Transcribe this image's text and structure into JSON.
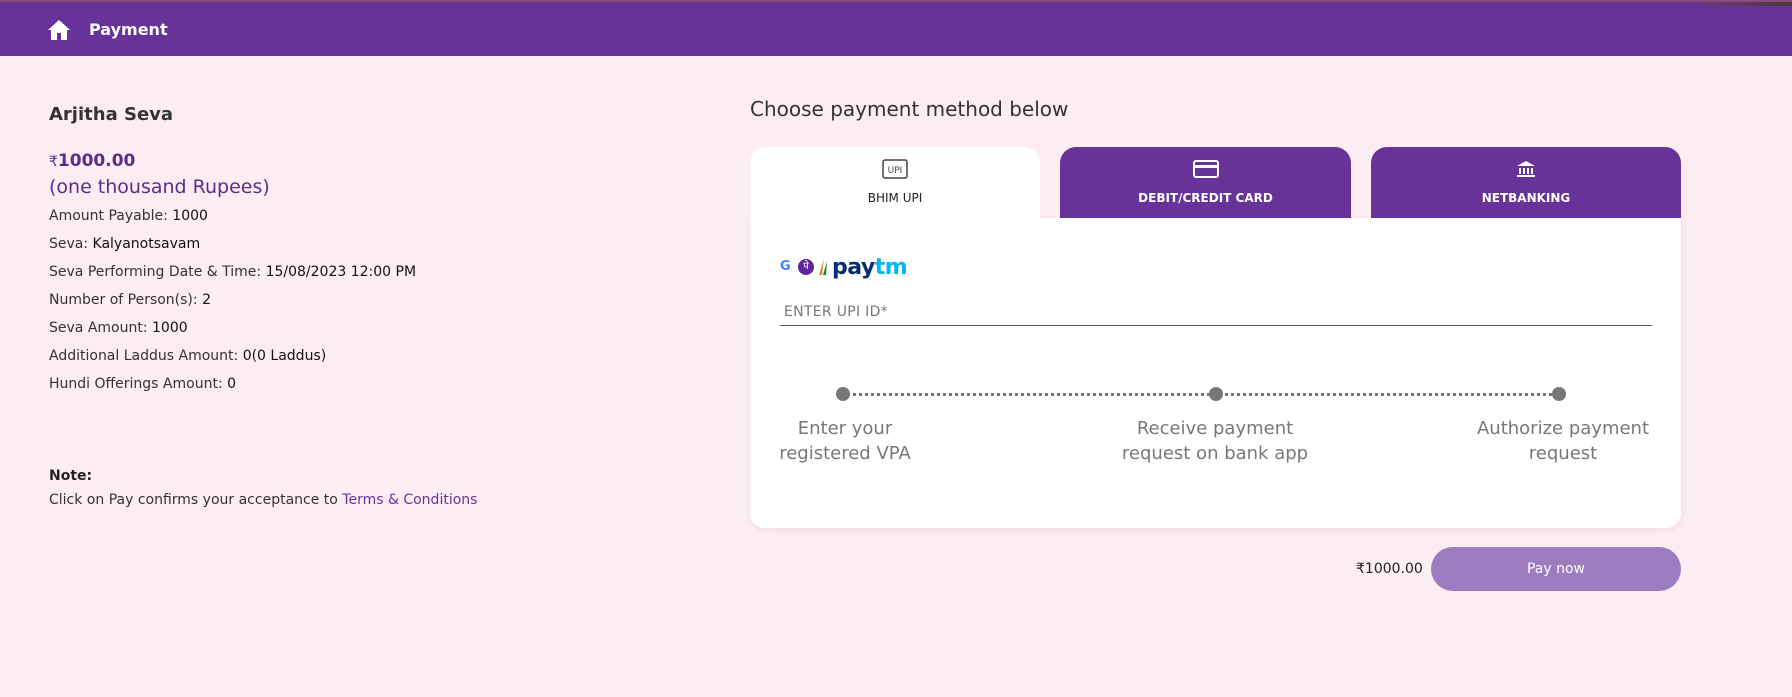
{
  "header": {
    "title": "Payment",
    "home_icon": "home-icon"
  },
  "seva": {
    "title": "Arjitha Seva",
    "currency": "₹",
    "amount": "1000.00",
    "amount_words": "(one thousand Rupees)",
    "details": [
      {
        "label": "Amount Payable: ",
        "value": "1000"
      },
      {
        "label": "Seva: ",
        "value": "Kalyanotsavam"
      },
      {
        "label": "Seva Performing Date & Time: ",
        "value": "15/08/2023 12:00 PM"
      },
      {
        "label": "Number of Person(s): ",
        "value": "2"
      },
      {
        "label": "Seva Amount: ",
        "value": "1000"
      },
      {
        "label": "Additional Laddus Amount: ",
        "value": "0(0 Laddus)"
      },
      {
        "label": "Hundi Offerings Amount: ",
        "value": "0"
      }
    ],
    "note_label": "Note:",
    "note_text": "Click on Pay confirms your acceptance to ",
    "terms_link": "Terms & Conditions"
  },
  "payment": {
    "heading": "Choose payment method below",
    "tabs": [
      {
        "label": "BHIM UPI",
        "icon": "upi-icon",
        "active": true
      },
      {
        "label": "DEBIT/CREDIT CARD",
        "icon": "credit-card-icon",
        "active": false
      },
      {
        "label": "NETBANKING",
        "icon": "bank-icon",
        "active": false
      }
    ],
    "upi_icon_text": "UPI",
    "brand_logos": {
      "google": "G",
      "phonepe": "पे",
      "paytm_1": "pay",
      "paytm_2": "tm"
    },
    "upi_placeholder": "ENTER UPI ID*",
    "upi_value": "",
    "steps": [
      {
        "line1": "Enter your",
        "line2": "registered VPA"
      },
      {
        "line1": "Receive payment",
        "line2": "request on bank app"
      },
      {
        "line1": "Authorize payment",
        "line2": "request"
      }
    ],
    "total": "₹1000.00",
    "pay_button": "Pay now",
    "colors": {
      "primary": "#673399",
      "background": "#fcedf3",
      "pay_button": "#9d7cc0"
    }
  }
}
